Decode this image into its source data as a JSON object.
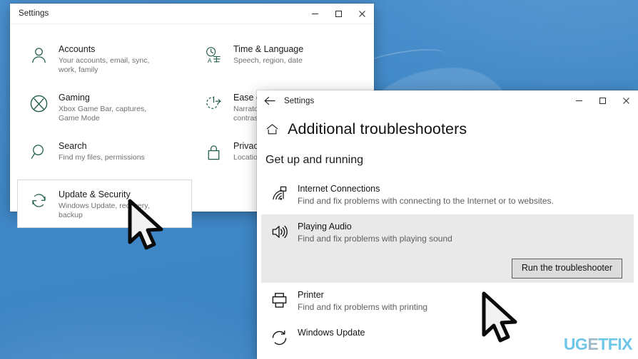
{
  "desktop": {
    "background_color": "#3f87c6"
  },
  "settings_home_window": {
    "title": "Settings",
    "caption": {
      "minimize": "minimize-icon",
      "maximize": "maximize-icon",
      "close": "close-icon"
    },
    "tiles": [
      {
        "icon": "person-icon",
        "title": "Accounts",
        "subtitle": "Your accounts, email, sync, work, family",
        "selected": false
      },
      {
        "icon": "clock-language-icon",
        "title": "Time & Language",
        "subtitle": "Speech, region, date",
        "selected": false
      },
      {
        "icon": "xbox-icon",
        "title": "Gaming",
        "subtitle": "Xbox Game Bar, captures, Game Mode",
        "selected": false
      },
      {
        "icon": "ease-of-access-icon",
        "title": "Ease of Access",
        "subtitle": "Narrator, magnifier, high contrast",
        "selected": false
      },
      {
        "icon": "magnifier-icon",
        "title": "Search",
        "subtitle": "Find my files, permissions",
        "selected": false
      },
      {
        "icon": "lock-icon",
        "title": "Privacy",
        "subtitle": "Location, camera, microphone",
        "selected": false
      },
      {
        "icon": "refresh-shield-icon",
        "title": "Update & Security",
        "subtitle": "Windows Update, recovery, backup",
        "selected": true
      }
    ]
  },
  "troubleshooters_window": {
    "title": "Settings",
    "back_icon": "back-arrow-icon",
    "home_icon": "home-icon",
    "page_title": "Additional troubleshooters",
    "section_heading": "Get up and running",
    "caption": {
      "minimize": "minimize-icon",
      "maximize": "maximize-icon",
      "close": "close-icon"
    },
    "items": [
      {
        "icon": "wifi-network-icon",
        "title": "Internet Connections",
        "description": "Find and fix problems with connecting to the Internet or to websites.",
        "selected": false,
        "action_label": null
      },
      {
        "icon": "speaker-icon",
        "title": "Playing Audio",
        "description": "Find and fix problems with playing sound",
        "selected": true,
        "action_label": "Run the troubleshooter"
      },
      {
        "icon": "printer-icon",
        "title": "Printer",
        "description": "Find and fix problems with printing",
        "selected": false,
        "action_label": null
      },
      {
        "icon": "update-arrow-icon",
        "title": "Windows Update",
        "description": "",
        "selected": false,
        "action_label": null
      }
    ]
  },
  "cursors": [
    {
      "name": "cursor-over-update-and-security"
    },
    {
      "name": "cursor-over-run-troubleshooter"
    }
  ],
  "watermark": {
    "part1": "UG",
    "part2": "E",
    "part3": "TFIX",
    "color_primary": "#6ec6e8",
    "color_secondary": "#9fb9c9"
  }
}
